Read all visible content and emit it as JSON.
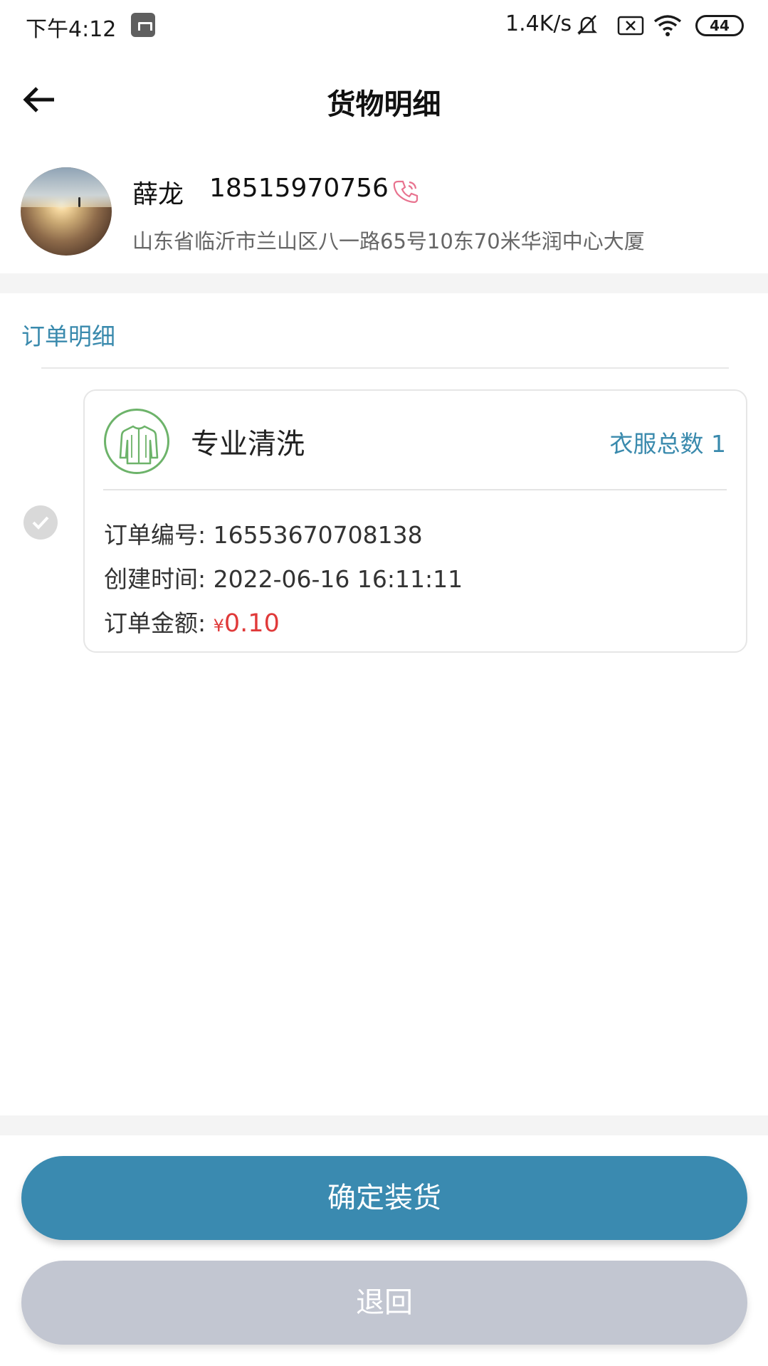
{
  "status_bar": {
    "time": "下午4:12",
    "net_speed": "1.4K/s",
    "battery": "44",
    "icons": [
      "mi-icon",
      "mute-bell-icon",
      "sim-x-icon",
      "wifi-icon",
      "battery-icon"
    ]
  },
  "header": {
    "title": "货物明细",
    "back_icon": "arrow-left-icon"
  },
  "contact": {
    "name": "薛龙",
    "phone": "18515970756",
    "phone_icon": "phone-call-icon",
    "address": "山东省临沂市兰山区八一路65号10东70米华润中心大厦"
  },
  "section": {
    "title": "订单明细"
  },
  "order": {
    "service_name": "专业清洗",
    "service_icon": "jacket-icon",
    "clothes_count_label": "衣服总数 1",
    "order_no_label": "订单编号:",
    "order_no": "16553670708138",
    "created_label": "创建时间:",
    "created_time": "2022-06-16 16:11:11",
    "amount_label": "订单金额:",
    "currency": "¥",
    "amount": "0.10",
    "selected": true
  },
  "actions": {
    "confirm_label": "确定装货",
    "return_label": "退回"
  },
  "colors": {
    "accent": "#3a8ab0",
    "link": "#3a8aad",
    "price": "#e03a3a",
    "icon_green": "#6db36a",
    "disabled_button": "#c2c6d1"
  }
}
